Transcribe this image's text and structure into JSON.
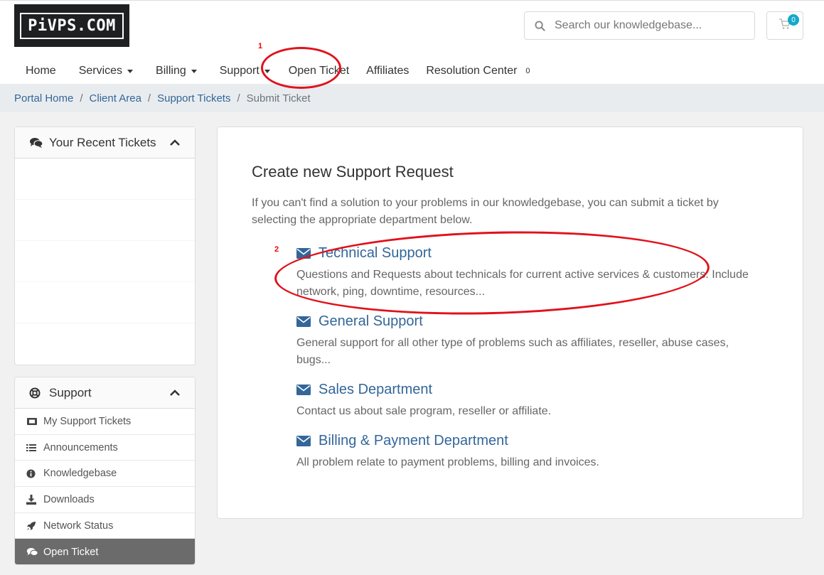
{
  "logo": {
    "text": "PiVPS.COM"
  },
  "search": {
    "placeholder": "Search our knowledgebase..."
  },
  "cart": {
    "count": "0"
  },
  "nav": {
    "home": "Home",
    "services": "Services",
    "billing": "Billing",
    "support": "Support",
    "open_ticket": "Open Ticket",
    "affiliates": "Affiliates",
    "resolution_center": "Resolution Center",
    "resolution_badge": "0"
  },
  "breadcrumb": {
    "portal_home": "Portal Home",
    "client_area": "Client Area",
    "support_tickets": "Support Tickets",
    "current": "Submit Ticket",
    "separator": "/"
  },
  "recent_panel": {
    "title": "Your Recent Tickets"
  },
  "support_panel": {
    "title": "Support",
    "items": [
      {
        "label": "My Support Tickets"
      },
      {
        "label": "Announcements"
      },
      {
        "label": "Knowledgebase"
      },
      {
        "label": "Downloads"
      },
      {
        "label": "Network Status"
      },
      {
        "label": "Open Ticket"
      }
    ]
  },
  "main": {
    "heading": "Create new Support Request",
    "intro": "If you can't find a solution to your problems in our knowledgebase, you can submit a ticket by selecting the appropriate department below.",
    "departments": [
      {
        "title": "Technical Support",
        "desc": "Questions and Requests about technicals for current active services & customers. Include network, ping, downtime, resources..."
      },
      {
        "title": "General Support",
        "desc": "General support for all other type of problems such as affiliates, reseller, abuse cases, bugs..."
      },
      {
        "title": "Sales Department",
        "desc": "Contact us about sale program, reseller or affiliate."
      },
      {
        "title": "Billing & Payment Department",
        "desc": "All problem relate to payment problems, billing and invoices."
      }
    ]
  },
  "annotations": {
    "marker1": "1",
    "marker2": "2"
  },
  "colors": {
    "link": "#336699",
    "annotation": "#e0121b",
    "badge": "#15a9c8",
    "active_menu": "#6b6b6b"
  }
}
